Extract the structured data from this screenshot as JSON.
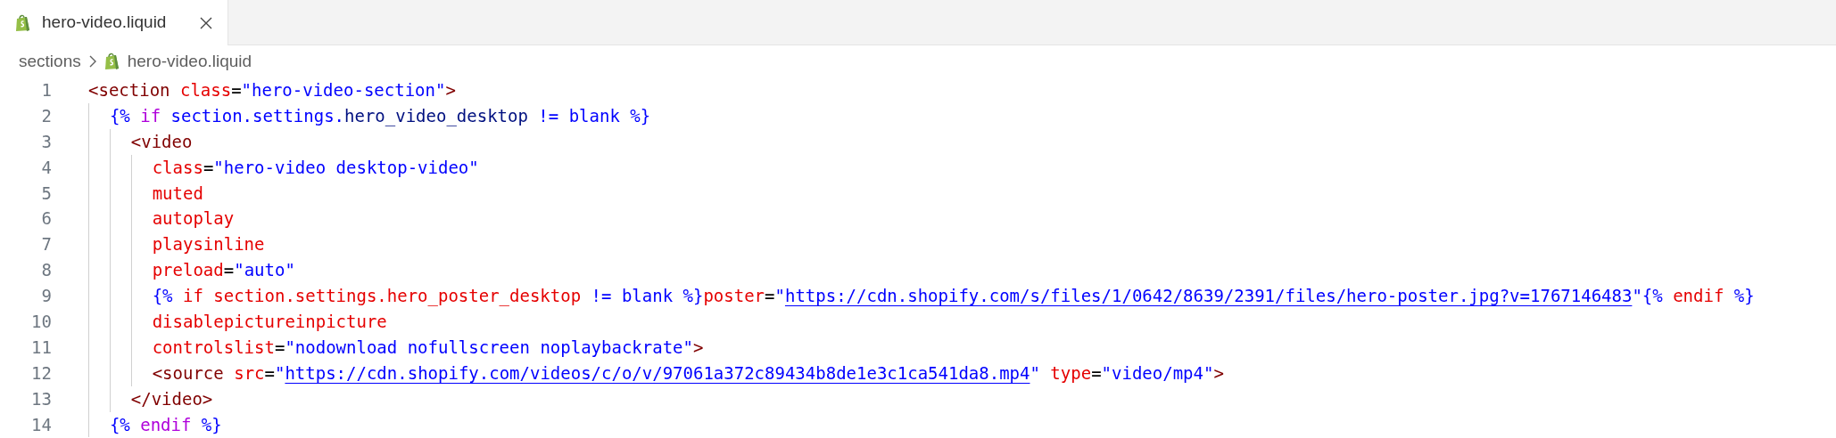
{
  "tabs": [
    {
      "label": "hero-video.liquid",
      "selected": true
    }
  ],
  "breadcrumb": [
    "sections",
    "hero-video.liquid"
  ],
  "lines": [
    {
      "number": "1",
      "tokens": [
        {
          "kind": "tag",
          "text": "<section "
        },
        {
          "kind": "attribute",
          "text": "class"
        },
        {
          "kind": "operator",
          "text": "="
        },
        {
          "kind": "string",
          "text": "\"hero-video-section\""
        },
        {
          "kind": "tag",
          "text": ">"
        }
      ]
    },
    {
      "number": "2",
      "tokens": [
        {
          "kind": "delimiter",
          "text": "  {% "
        },
        {
          "kind": "keyword",
          "text": "if "
        },
        {
          "kind": "variable",
          "text": "section.settings."
        },
        {
          "kind": "property",
          "text": "hero_video_desktop "
        },
        {
          "kind": "delimiter",
          "text": "!= blank %}"
        }
      ]
    },
    {
      "number": "3",
      "tokens": [
        {
          "kind": "tag",
          "text": "    <video"
        }
      ]
    },
    {
      "number": "4",
      "tokens": [
        {
          "kind": "attribute",
          "text": "      class"
        },
        {
          "kind": "operator",
          "text": "="
        },
        {
          "kind": "string",
          "text": "\"hero-video desktop-video\""
        }
      ]
    },
    {
      "number": "5",
      "tokens": [
        {
          "kind": "attribute",
          "text": "      muted"
        }
      ]
    },
    {
      "number": "6",
      "tokens": [
        {
          "kind": "attribute",
          "text": "      autoplay"
        }
      ]
    },
    {
      "number": "7",
      "tokens": [
        {
          "kind": "attribute",
          "text": "      playsinline"
        }
      ]
    },
    {
      "number": "8",
      "tokens": [
        {
          "kind": "attribute",
          "text": "      preload"
        },
        {
          "kind": "operator",
          "text": "="
        },
        {
          "kind": "string",
          "text": "\"auto\""
        }
      ]
    },
    {
      "number": "9",
      "tokens": [
        {
          "kind": "delimiter",
          "text": "      {%"
        },
        {
          "kind": "attribute",
          "text": " if section.settings.hero_poster_desktop "
        },
        {
          "kind": "delimiter",
          "text": "!= blank %}"
        },
        {
          "kind": "attribute",
          "text": "poster"
        },
        {
          "kind": "operator",
          "text": "="
        },
        {
          "kind": "string",
          "text": "\""
        },
        {
          "kind": "link",
          "text": "https://cdn.shopify.com/s/files/1/0642/8639/2391/files/hero-poster.jpg?v=1767146483"
        },
        {
          "kind": "string",
          "text": "\""
        },
        {
          "kind": "delimiter",
          "text": "{%"
        },
        {
          "kind": "attribute",
          "text": " endif "
        },
        {
          "kind": "delimiter",
          "text": "%}"
        }
      ]
    },
    {
      "number": "10",
      "tokens": [
        {
          "kind": "attribute",
          "text": "      disablepictureinpicture"
        }
      ]
    },
    {
      "number": "11",
      "tokens": [
        {
          "kind": "attribute",
          "text": "      controlslist"
        },
        {
          "kind": "operator",
          "text": "="
        },
        {
          "kind": "string",
          "text": "\"nodownload nofullscreen noplaybackrate\""
        },
        {
          "kind": "tag",
          "text": ">"
        }
      ]
    },
    {
      "number": "12",
      "tokens": [
        {
          "kind": "tag",
          "text": "      <source "
        },
        {
          "kind": "attribute",
          "text": "src"
        },
        {
          "kind": "operator",
          "text": "="
        },
        {
          "kind": "string",
          "text": "\""
        },
        {
          "kind": "link",
          "text": "https://cdn.shopify.com/videos/c/o/v/97061a372c89434b8de1e3c1ca541da8.mp4"
        },
        {
          "kind": "string",
          "text": "\" "
        },
        {
          "kind": "attribute",
          "text": "type"
        },
        {
          "kind": "operator",
          "text": "="
        },
        {
          "kind": "string",
          "text": "\"video/mp4\""
        },
        {
          "kind": "tag",
          "text": ">"
        }
      ]
    },
    {
      "number": "13",
      "tokens": [
        {
          "kind": "tag",
          "text": "    </video>"
        }
      ]
    },
    {
      "number": "14",
      "tokens": [
        {
          "kind": "delimiter",
          "text": "  {% "
        },
        {
          "kind": "keyword",
          "text": "endif "
        },
        {
          "kind": "delimiter",
          "text": "%}"
        }
      ]
    }
  ]
}
